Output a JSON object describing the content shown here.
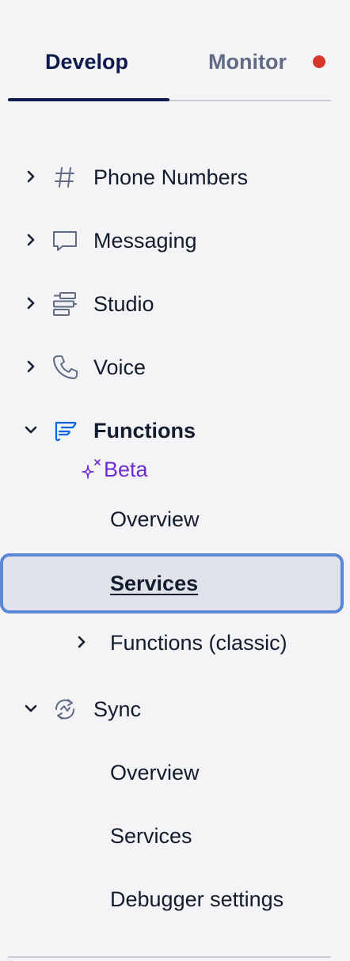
{
  "tabs": {
    "develop": "Develop",
    "monitor": "Monitor"
  },
  "nav": {
    "phone_numbers": "Phone Numbers",
    "messaging": "Messaging",
    "studio": "Studio",
    "voice": "Voice",
    "functions": "Functions",
    "functions_badge": "Beta",
    "functions_children": [
      "Overview",
      "Services",
      "Functions (classic)"
    ],
    "sync": "Sync",
    "sync_children": [
      "Overview",
      "Services",
      "Debugger settings"
    ]
  },
  "icons": {
    "phone_numbers": "hash-icon",
    "messaging": "chat-bubble-icon",
    "studio": "studio-flow-icon",
    "voice": "phone-icon",
    "functions": "functions-icon",
    "beta": "sparkle-icon",
    "sync": "sync-icon"
  },
  "colors": {
    "active_tab": "#0d1a4b",
    "inactive_tab": "#606b85",
    "notification": "#d6352a",
    "beta": "#6d2ed1",
    "functions_icon": "#0263e0",
    "selected_border": "#5b87d8",
    "selected_bg": "#e1e3ea"
  }
}
